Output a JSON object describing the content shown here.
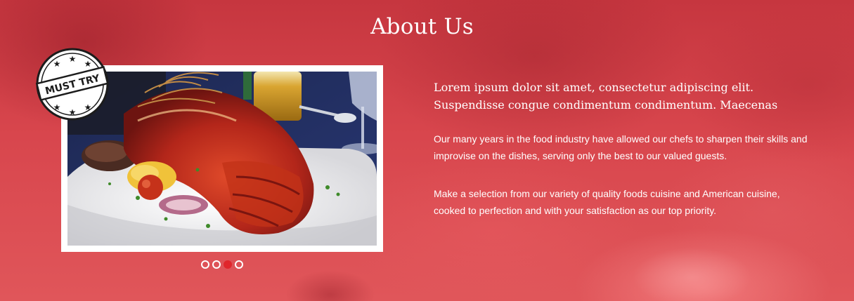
{
  "section": {
    "title": "About Us"
  },
  "badge": {
    "label": "MUST TRY",
    "icon": "star-stamp-icon"
  },
  "content": {
    "lead": "Lorem ipsum dolor sit amet, consectetur adipiscing elit. Suspendisse congue condimentum condimentum. Maecenas",
    "paragraphs": [
      "Our many years in the food industry have allowed our chefs to sharpen their skills and improvise on the dishes, serving only the best to our valued guests.",
      "Make a selection from our variety of quality foods cuisine and American cuisine, cooked to perfection and with your satisfaction as our top priority."
    ]
  },
  "carousel": {
    "slide_count": 4,
    "active_index": 2
  },
  "colors": {
    "background": "#d9454e",
    "text": "#ffffff",
    "active_dot": "#e0262c"
  }
}
